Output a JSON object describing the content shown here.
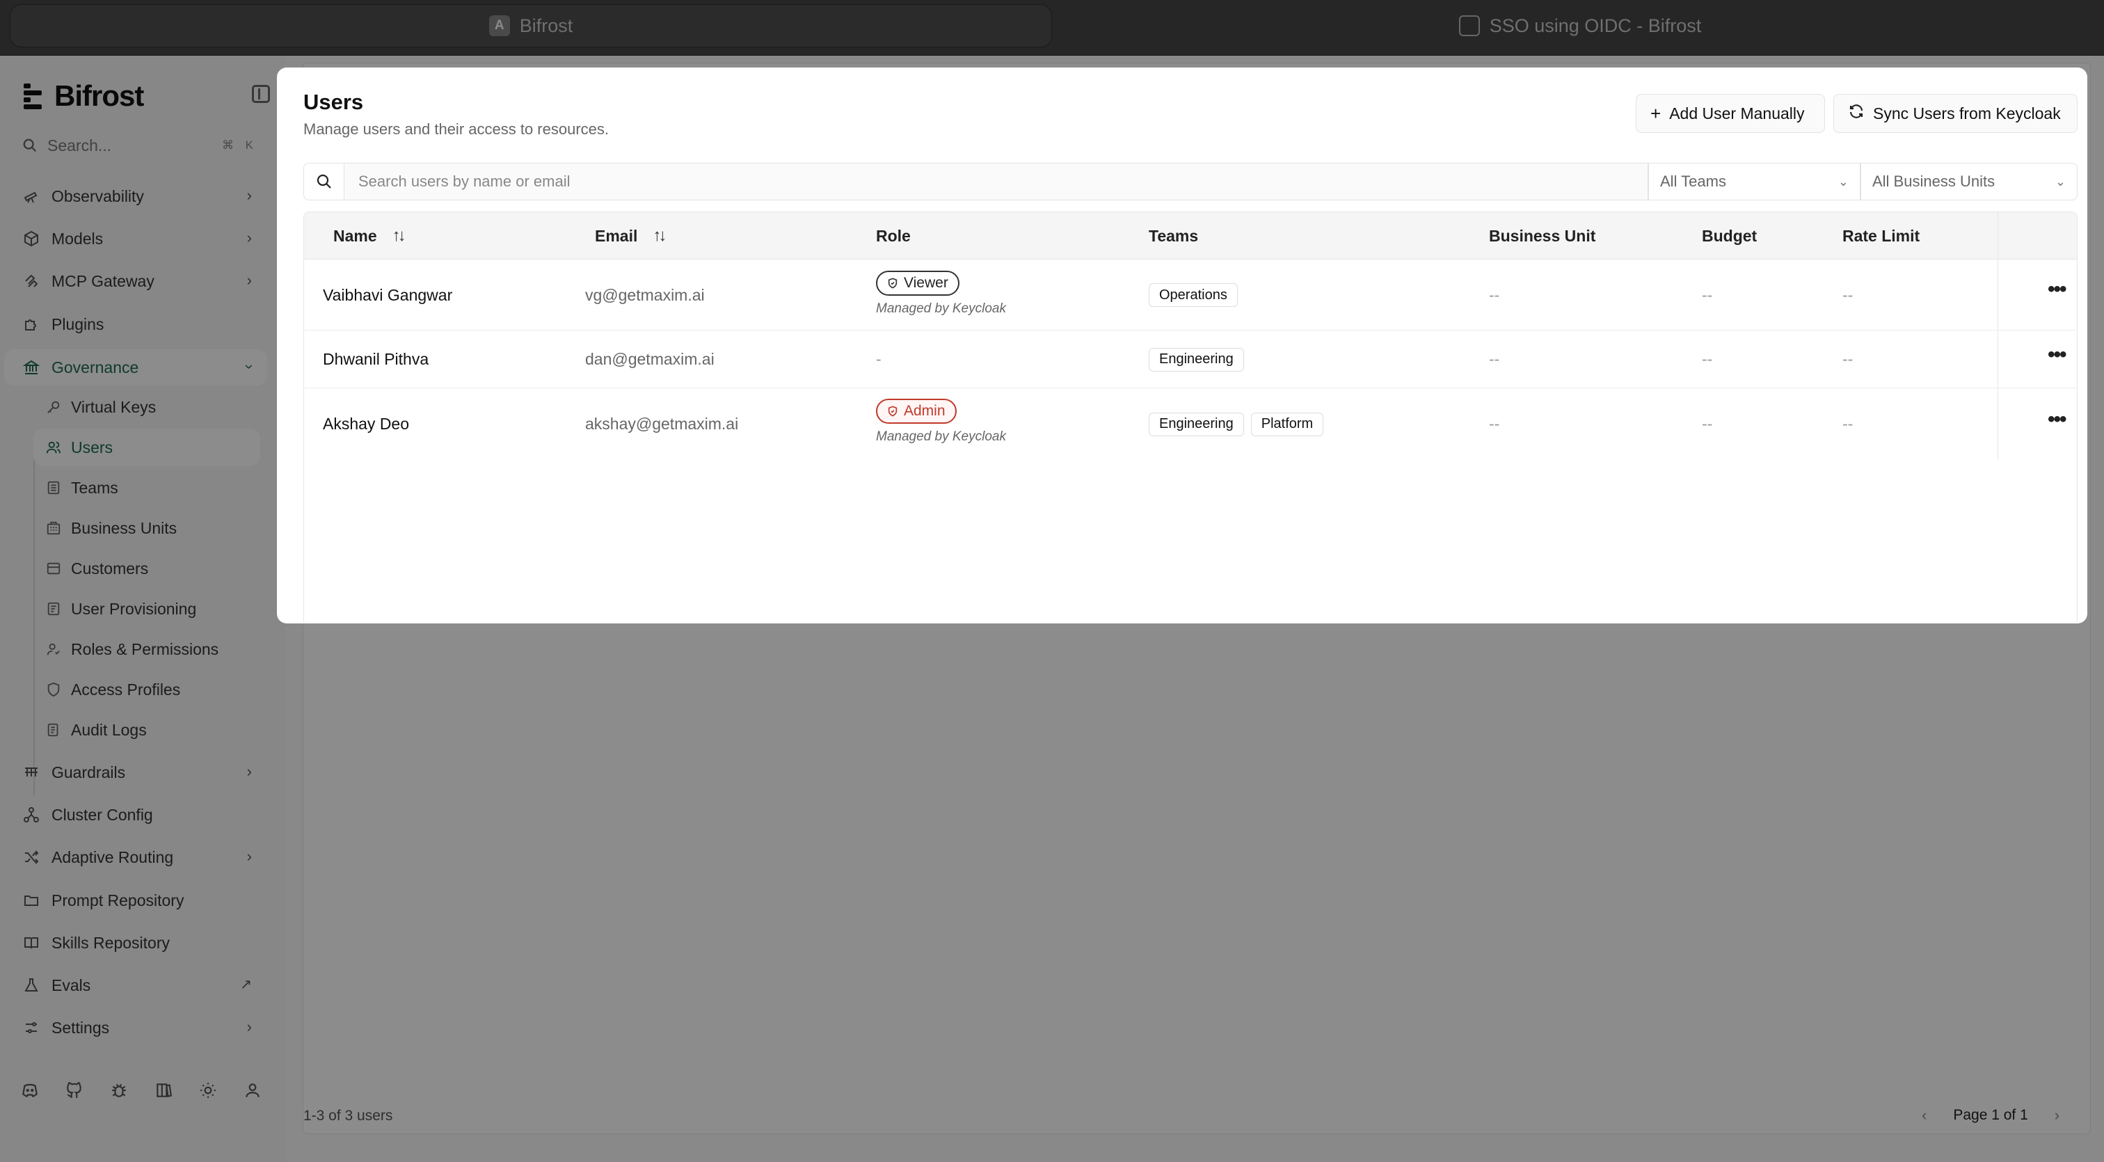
{
  "browser": {
    "tabs": [
      {
        "label": "Bifrost",
        "favicon": "A"
      },
      {
        "label": "SSO using OIDC - Bifrost",
        "favicon": "bifrost-icon"
      }
    ]
  },
  "sidebar": {
    "brand": "Bifrost",
    "search_placeholder": "Search...",
    "search_shortcut": "⌘ K",
    "items": [
      {
        "label": "Observability",
        "icon": "telescope-icon",
        "has_chevron": true
      },
      {
        "label": "Models",
        "icon": "cube-icon",
        "has_chevron": true
      },
      {
        "label": "MCP Gateway",
        "icon": "mcp-icon",
        "has_chevron": true
      },
      {
        "label": "Plugins",
        "icon": "puzzle-icon",
        "has_chevron": false
      },
      {
        "label": "Governance",
        "icon": "landmark-icon",
        "has_chevron": true,
        "expanded": true
      },
      {
        "label": "Guardrails",
        "icon": "guardrails-icon",
        "has_chevron": true
      },
      {
        "label": "Cluster Config",
        "icon": "network-icon",
        "has_chevron": false
      },
      {
        "label": "Adaptive Routing",
        "icon": "shuffle-icon",
        "has_chevron": true
      },
      {
        "label": "Prompt Repository",
        "icon": "folder-icon",
        "has_chevron": false
      },
      {
        "label": "Skills Repository",
        "icon": "book-icon",
        "has_chevron": false
      },
      {
        "label": "Evals",
        "icon": "flask-icon",
        "external": true
      },
      {
        "label": "Settings",
        "icon": "sliders-icon",
        "has_chevron": true
      }
    ],
    "governance_sub": [
      {
        "label": "Virtual Keys",
        "icon": "key-icon"
      },
      {
        "label": "Users",
        "icon": "users-icon",
        "active": true
      },
      {
        "label": "Teams",
        "icon": "teams-icon"
      },
      {
        "label": "Business Units",
        "icon": "building-icon"
      },
      {
        "label": "Customers",
        "icon": "customers-icon"
      },
      {
        "label": "User Provisioning",
        "icon": "provisioning-icon"
      },
      {
        "label": "Roles & Permissions",
        "icon": "user-role-icon"
      },
      {
        "label": "Access Profiles",
        "icon": "shield-icon"
      },
      {
        "label": "Audit Logs",
        "icon": "logs-icon"
      }
    ],
    "footer_icons": [
      "discord-icon",
      "github-icon",
      "bug-icon",
      "docs-icon",
      "theme-icon",
      "profile-icon"
    ]
  },
  "page": {
    "status": "1-3 of 3 users",
    "pagination": "Page 1 of 1"
  },
  "dialog": {
    "title": "Users",
    "subtitle": "Manage users and their access to resources.",
    "add_button": "Add User Manually",
    "sync_button": "Sync Users from Keycloak",
    "search_placeholder": "Search users by name or email",
    "filter_teams": "All Teams",
    "filter_business_units": "All Business Units",
    "columns": [
      "Name",
      "Email",
      "Role",
      "Teams",
      "Business Unit",
      "Budget",
      "Rate Limit"
    ],
    "rows": [
      {
        "name": "Vaibhavi Gangwar",
        "email": "vg@getmaxim.ai",
        "role": "Viewer",
        "role_style": "viewer",
        "role_note": "Managed by Keycloak",
        "teams": [
          "Operations"
        ],
        "business_unit": "--",
        "budget": "--",
        "rate_limit": "--"
      },
      {
        "name": "Dhwanil Pithva",
        "email": "dan@getmaxim.ai",
        "role": "-",
        "role_style": "none",
        "role_note": "",
        "teams": [
          "Engineering"
        ],
        "business_unit": "--",
        "budget": "--",
        "rate_limit": "--"
      },
      {
        "name": "Akshay Deo",
        "email": "akshay@getmaxim.ai",
        "role": "Admin",
        "role_style": "admin",
        "role_note": "Managed by Keycloak",
        "teams": [
          "Engineering",
          "Platform"
        ],
        "business_unit": "--",
        "budget": "--",
        "rate_limit": "--"
      }
    ]
  },
  "colors": {
    "accent": "#1e6b52",
    "admin_red": "#c0392b"
  }
}
